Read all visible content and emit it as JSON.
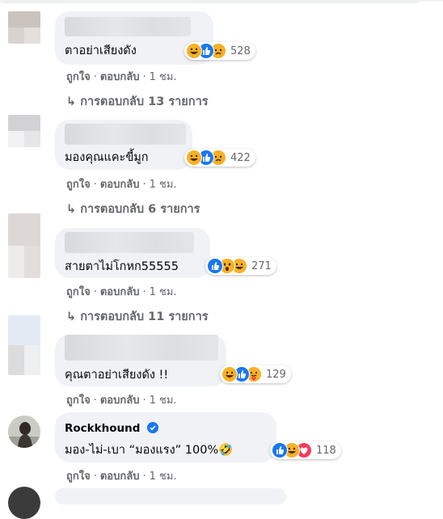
{
  "comments": [
    {
      "text": "ตาอย่าเสียงดัง",
      "reactions": [
        "haha",
        "like",
        "sad"
      ],
      "count": "528",
      "like": "ถูกใจ",
      "reply": "ตอบกลับ",
      "time": "1 ชม.",
      "replies": "↳ การตอบกลับ 13 รายการ"
    },
    {
      "text": "มองคุณแคะขี้มูก",
      "reactions": [
        "haha",
        "like",
        "sad"
      ],
      "count": "422",
      "like": "ถูกใจ",
      "reply": "ตอบกลับ",
      "time": "1 ชม.",
      "replies": "↳ การตอบกลับ 6 รายการ"
    },
    {
      "text": "สายตาไม่โกหก55555",
      "reactions": [
        "like",
        "wow",
        "haha"
      ],
      "count": "271",
      "like": "ถูกใจ",
      "reply": "ตอบกลับ",
      "time": "1 ชม.",
      "replies": "↳ การตอบกลับ 11 รายการ"
    },
    {
      "text": "คุณตาอย่าเสียงดัง !!",
      "reactions": [
        "haha",
        "like",
        "care"
      ],
      "count": "129",
      "like": "ถูกใจ",
      "reply": "ตอบกลับ",
      "time": "1 ชม."
    },
    {
      "name": "Rockkhound",
      "text": "มอง-ไม่-เบา “มองแรง” 100%🤣",
      "reactions": [
        "like",
        "haha",
        "love"
      ],
      "count": "118",
      "like": "ถูกใจ",
      "reply": "ตอบกลับ",
      "time": "1 ชม."
    }
  ],
  "colors": {
    "bubble": "#f0f2f5",
    "meta": "#65676b",
    "like": "#1877f2",
    "haha": "#f7b125",
    "love": "#f33e58"
  }
}
